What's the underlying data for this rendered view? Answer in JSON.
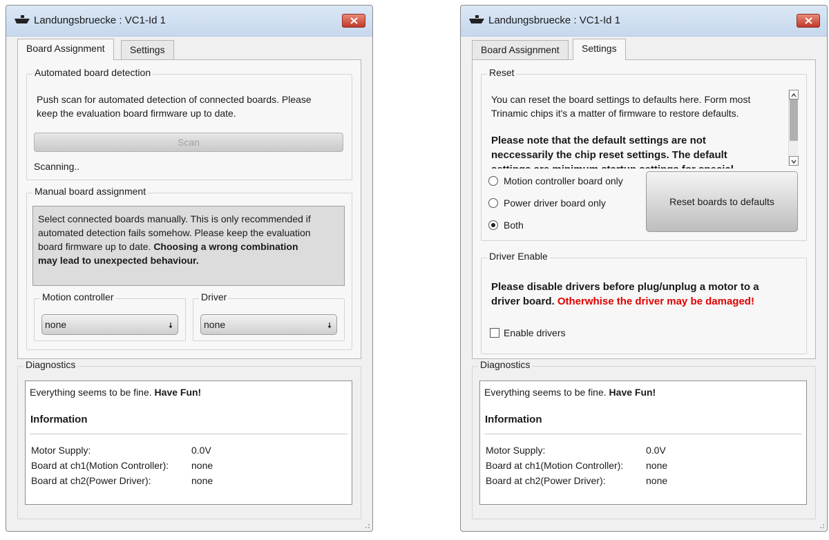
{
  "window_title": "Landungsbruecke : VC1-Id 1",
  "tabs": {
    "board_assignment": "Board Assignment",
    "settings": "Settings"
  },
  "left": {
    "auto_group": {
      "title": "Automated board detection",
      "desc_line1": "Push scan for automated detection of connected boards. Please",
      "desc_line2": "keep the evaluation board firmware up to date.",
      "scan_label": "Scan",
      "status": "Scanning.."
    },
    "manual_group": {
      "title": "Manual board assignment",
      "info_line1": "Select connected boards manually. This is only recommended if",
      "info_line2": "automated detection fails somehow. Please keep the evaluation",
      "info_line3_normal": "board firmware up to date.",
      "info_line3_bold": "Choosing a wrong combination",
      "info_line4_bold": "may lead to unexpected behaviour.",
      "motion_title": "Motion controller",
      "motion_value": "none",
      "driver_title": "Driver",
      "driver_value": "none"
    }
  },
  "right": {
    "reset_group": {
      "title": "Reset",
      "text_line1": "You can reset the board settings to defaults here. Form most",
      "text_line2": "Trinamic chips it's a matter of firmware to restore defaults.",
      "bold_line1": "Please note that the default settings are not",
      "bold_line2": "neccessarily the chip reset settings. The default",
      "bold_line3": "settings are minimum startup settings for special",
      "radio_motion": "Motion controller board only",
      "radio_power": "Power driver board only",
      "radio_both": "Both",
      "reset_button": "Reset boards to defaults"
    },
    "driver_enable_group": {
      "title": "Driver Enable",
      "warn_line1": "Please disable drivers before plug/unplug a motor to a",
      "warn_line2_normal": "driver board.",
      "warn_line2_red": "Otherwhise the driver may be damaged!",
      "checkbox_label": "Enable drivers"
    }
  },
  "diagnostics": {
    "title": "Diagnostics",
    "msg_normal": "Everything seems to be fine.",
    "msg_bold": "Have Fun!",
    "info_heading": "Information",
    "rows": [
      {
        "label": "Motor Supply:",
        "value": "0.0V"
      },
      {
        "label": "Board at ch1(Motion Controller):",
        "value": "none"
      },
      {
        "label": "Board at ch2(Power Driver):",
        "value": "none"
      }
    ]
  },
  "colors": {
    "close_button": "#c0392b",
    "warning_red": "#e00000"
  }
}
